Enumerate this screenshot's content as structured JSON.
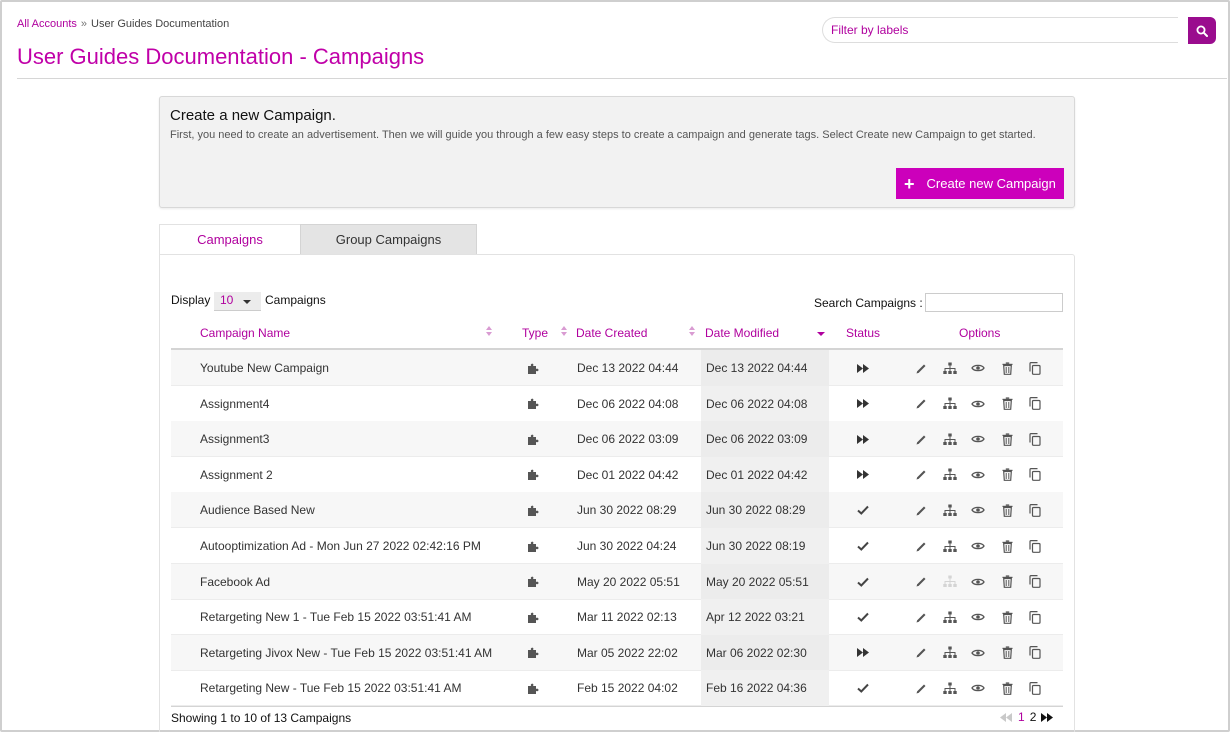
{
  "breadcrumb": {
    "root": "All Accounts",
    "separator": "»",
    "current": "User Guides Documentation"
  },
  "page_title": "User Guides Documentation - Campaigns",
  "filter": {
    "placeholder": "Filter by labels"
  },
  "create_box": {
    "title": "Create a new Campaign.",
    "description": "First, you need to create an advertisement. Then we will guide you through a few easy steps to create a campaign and generate tags. Select Create new Campaign to get started.",
    "button_label": "Create new Campaign"
  },
  "tabs": [
    {
      "label": "Campaigns",
      "active": true
    },
    {
      "label": "Group Campaigns",
      "active": false
    }
  ],
  "table_controls": {
    "display_label": "Display",
    "display_value": "10",
    "display_suffix": "Campaigns",
    "search_label": "Search Campaigns :"
  },
  "columns": {
    "name": "Campaign Name",
    "type": "Type",
    "created": "Date Created",
    "modified": "Date Modified",
    "status": "Status",
    "options": "Options"
  },
  "rows": [
    {
      "name": "Youtube New Campaign",
      "created": "Dec 13 2022 04:44",
      "modified": "Dec 13 2022 04:44",
      "status": "play"
    },
    {
      "name": "Assignment4",
      "created": "Dec 06 2022 04:08",
      "modified": "Dec 06 2022 04:08",
      "status": "play"
    },
    {
      "name": "Assignment3",
      "created": "Dec 06 2022 03:09",
      "modified": "Dec 06 2022 03:09",
      "status": "play"
    },
    {
      "name": "Assignment 2",
      "created": "Dec 01 2022 04:42",
      "modified": "Dec 01 2022 04:42",
      "status": "play"
    },
    {
      "name": "Audience Based New",
      "created": "Jun 30 2022 08:29",
      "modified": "Jun 30 2022 08:29",
      "status": "check"
    },
    {
      "name": "Autooptimization Ad - Mon Jun 27 2022 02:42:16 PM",
      "created": "Jun 30 2022 04:24",
      "modified": "Jun 30 2022 08:19",
      "status": "check"
    },
    {
      "name": "Facebook Ad",
      "created": "May 20 2022 05:51",
      "modified": "May 20 2022 05:51",
      "status": "check",
      "hierarchy_disabled": true
    },
    {
      "name": "Retargeting New 1 - Tue Feb 15 2022 03:51:41 AM",
      "created": "Mar 11 2022 02:13",
      "modified": "Apr 12 2022 03:21",
      "status": "check"
    },
    {
      "name": "Retargeting Jivox New - Tue Feb 15 2022 03:51:41 AM",
      "created": "Mar 05 2022 22:02",
      "modified": "Mar 06 2022 02:30",
      "status": "play"
    },
    {
      "name": "Retargeting New - Tue Feb 15 2022 03:51:41 AM",
      "created": "Feb 15 2022 04:02",
      "modified": "Feb 16 2022 04:36",
      "status": "check"
    }
  ],
  "footer": {
    "showing": "Showing 1 to 10 of 13 Campaigns",
    "pages": [
      "1",
      "2"
    ],
    "current_page": "1"
  },
  "colors": {
    "accent": "#c000a8",
    "button": "#cc00bb",
    "search_button": "#9a0c8e"
  },
  "icons": {
    "type": "puzzle-icon",
    "status_play": "fast-forward-icon",
    "status_check": "check-icon",
    "options": [
      "pencil-icon",
      "hierarchy-icon",
      "eye-icon",
      "trash-icon",
      "copy-icon"
    ]
  }
}
